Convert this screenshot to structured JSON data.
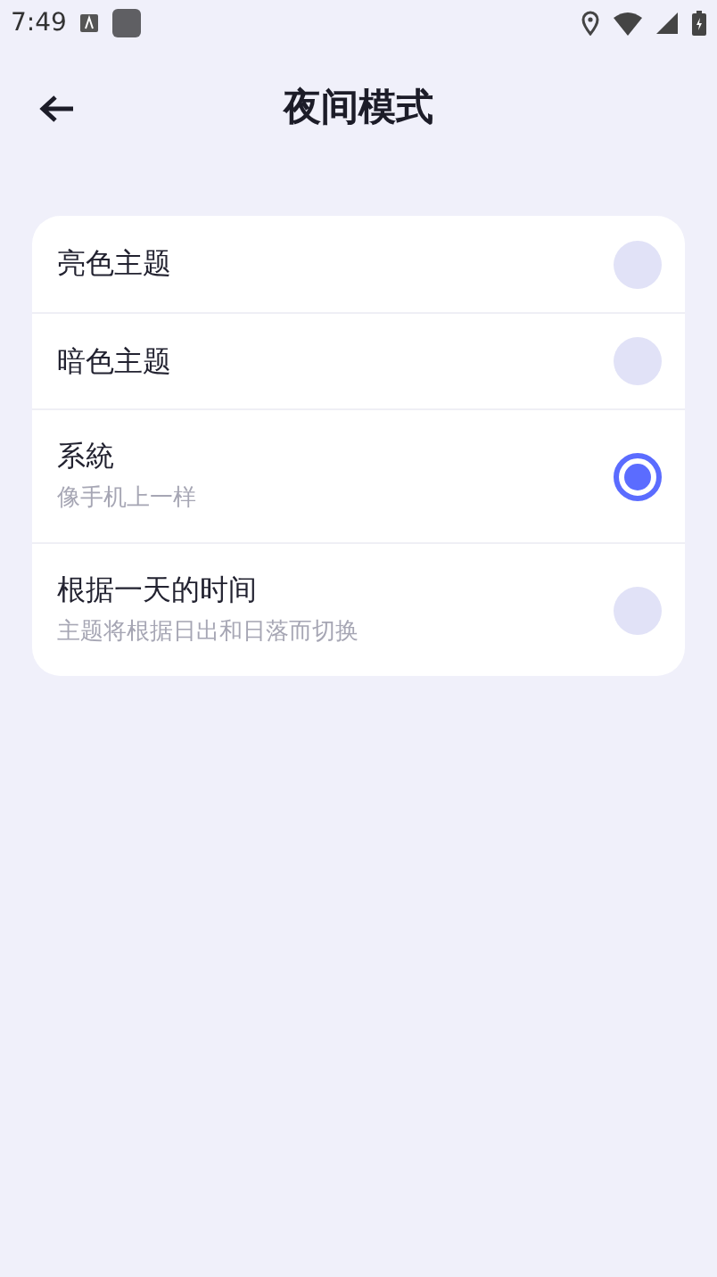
{
  "status_bar": {
    "time": "7:49"
  },
  "header": {
    "title": "夜间模式"
  },
  "options": [
    {
      "label": "亮色主题",
      "selected": false
    },
    {
      "label": "暗色主题",
      "selected": false
    },
    {
      "label": "系統",
      "description": "像手机上一样",
      "selected": true
    },
    {
      "label": "根据一天的时间",
      "description": "主题将根据日出和日落而切换",
      "selected": false
    }
  ]
}
